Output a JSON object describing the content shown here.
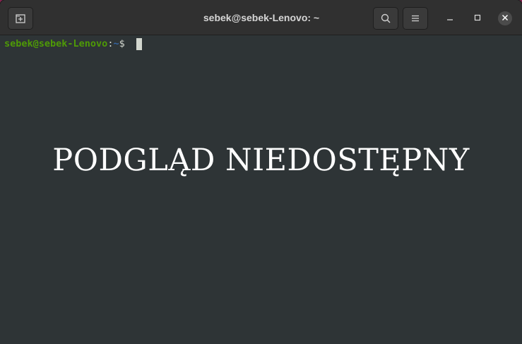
{
  "window": {
    "title": "sebek@sebek-Lenovo: ~"
  },
  "titlebar": {
    "buttons": {
      "new_tab_icon": "new-tab-icon",
      "search_icon": "search-icon",
      "menu_icon": "hamburger-menu-icon",
      "minimize_icon": "minimize-icon",
      "maximize_icon": "maximize-icon",
      "close_icon": "close-icon"
    }
  },
  "terminal": {
    "prompt_user_host": "sebek@sebek-Lenovo",
    "prompt_separator": ":",
    "prompt_path": "~",
    "prompt_symbol": "$ ",
    "colors": {
      "background": "#2e3436",
      "user_host": "#4e9a06",
      "path": "#3465a4",
      "text": "#d3d7cf"
    }
  },
  "overlay": {
    "watermark_text": "PODGLĄD NIEDOSTĘPNY"
  }
}
